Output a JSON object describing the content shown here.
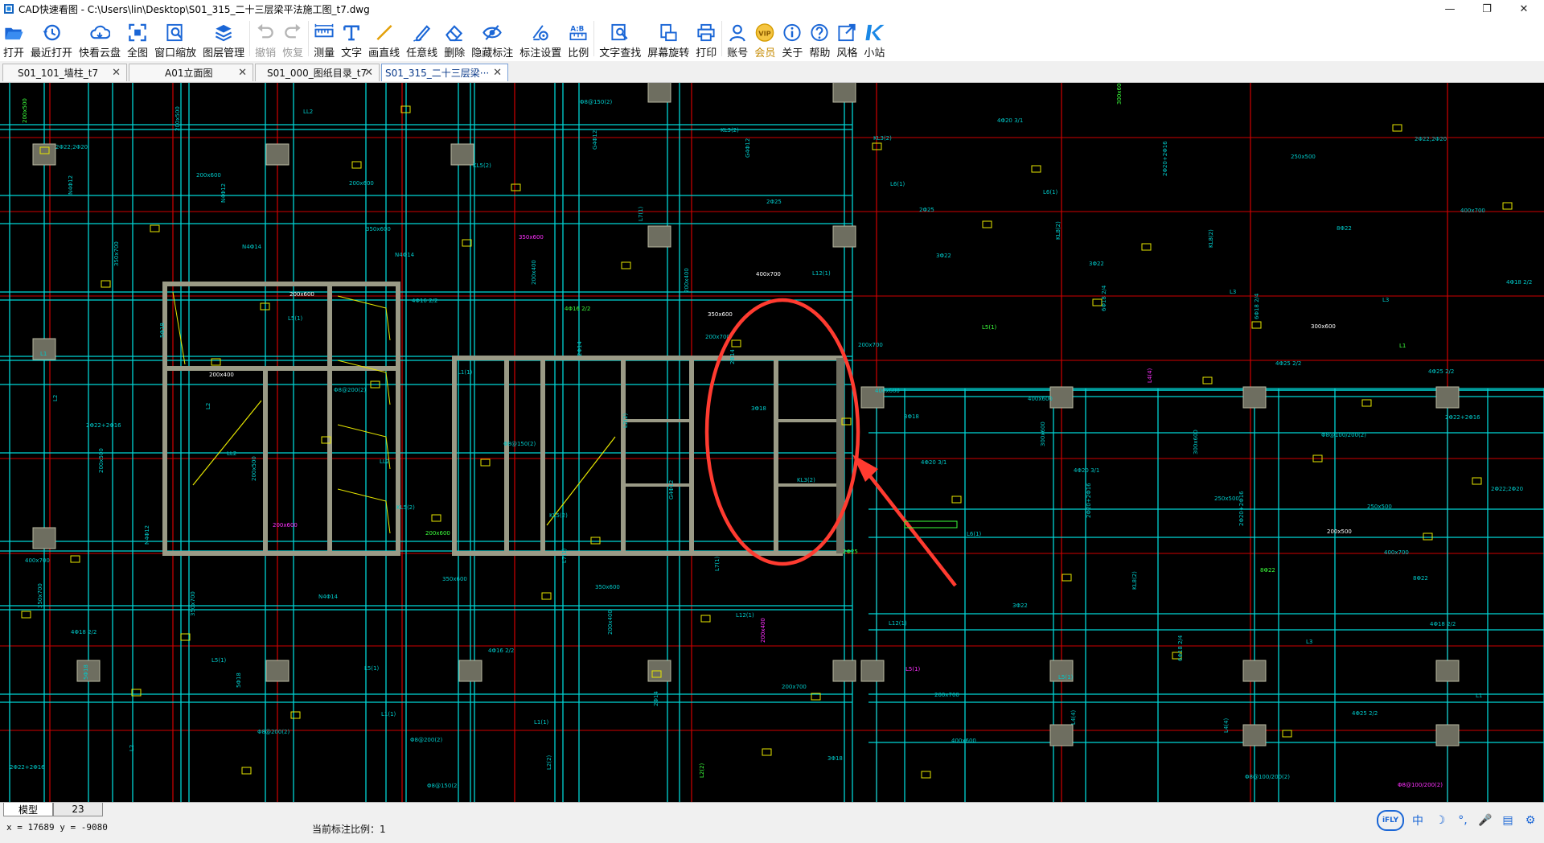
{
  "window": {
    "title": "CAD快速看图 - C:\\Users\\lin\\Desktop\\S01_315_二十三层梁平法施工图_t7.dwg",
    "controls": [
      "—",
      "❐",
      "✕"
    ]
  },
  "toolbar": {
    "items": [
      {
        "key": "open",
        "label": "打开",
        "icon": "folder-open-icon"
      },
      {
        "key": "recent",
        "label": "最近打开",
        "icon": "clock-history-icon"
      },
      {
        "key": "cloud",
        "label": "快看云盘",
        "icon": "cloud-icon"
      },
      {
        "key": "fit",
        "label": "全图",
        "icon": "fit-all-icon"
      },
      {
        "key": "zoomwin",
        "label": "窗口缩放",
        "icon": "zoom-window-icon"
      },
      {
        "key": "layers",
        "label": "图层管理",
        "icon": "layers-icon"
      },
      {
        "key": "undo",
        "label": "撤销",
        "icon": "undo-icon",
        "disabled": true
      },
      {
        "key": "redo",
        "label": "恢复",
        "icon": "redo-icon",
        "disabled": true
      },
      {
        "key": "measure",
        "label": "测量",
        "icon": "ruler-icon"
      },
      {
        "key": "text",
        "label": "文字",
        "icon": "text-T-icon"
      },
      {
        "key": "line",
        "label": "画直线",
        "icon": "line-icon"
      },
      {
        "key": "freeline",
        "label": "任意线",
        "icon": "pen-icon"
      },
      {
        "key": "erase",
        "label": "删除",
        "icon": "eraser-icon"
      },
      {
        "key": "hide",
        "label": "隐藏标注",
        "icon": "eye-hide-icon"
      },
      {
        "key": "dimset",
        "label": "标注设置",
        "icon": "dimension-settings-icon"
      },
      {
        "key": "scale",
        "label": "比例",
        "icon": "scale-ab-icon"
      },
      {
        "key": "findtext",
        "label": "文字查找",
        "icon": "find-text-icon"
      },
      {
        "key": "rotate",
        "label": "屏幕旋转",
        "icon": "rotate-screen-icon"
      },
      {
        "key": "print",
        "label": "打印",
        "icon": "printer-icon"
      },
      {
        "key": "account",
        "label": "账号",
        "icon": "user-icon"
      },
      {
        "key": "vip",
        "label": "会员",
        "icon": "vip-badge-icon",
        "vip": true
      },
      {
        "key": "about",
        "label": "关于",
        "icon": "info-icon"
      },
      {
        "key": "help",
        "label": "帮助",
        "icon": "help-icon"
      },
      {
        "key": "style",
        "label": "风格",
        "icon": "style-share-icon"
      },
      {
        "key": "site",
        "label": "小站",
        "icon": "k-logo-icon"
      }
    ]
  },
  "tabs": [
    {
      "label": "S01_101_墙柱_t7",
      "active": false
    },
    {
      "label": "A01立面图",
      "active": false
    },
    {
      "label": "S01_000_图纸目录_t7",
      "active": false
    },
    {
      "label": "S01_315_二十三层梁···",
      "active": true
    }
  ],
  "tab_close": "✕",
  "layout_tabs": {
    "model": "模型",
    "layout": "23"
  },
  "status": {
    "coords": "x = 17689  y = -9080",
    "scale": "当前标注比例：1"
  },
  "ime": {
    "logo": "iFLY",
    "items": [
      "中",
      "☽",
      "°,",
      "🎤",
      "▤",
      "⚙"
    ]
  },
  "drawing": {
    "colors": {
      "background": "#000000",
      "beam": "#00d5d5",
      "axis": "#d00000",
      "wall": "#9a9a86",
      "text_cyan": "#00c8c8",
      "text_green": "#3cff3c",
      "text_magenta": "#ff30ff",
      "yellow": "#e6e600",
      "markup": "#ff3b30"
    },
    "annotations": [
      "200x500",
      "200x600",
      "350x600",
      "200x400",
      "200x700",
      "400x600",
      "300x600",
      "250x500",
      "400x700",
      "350x700",
      "L5(1)",
      "L1(1)",
      "L2(2)",
      "KL3(2)",
      "L6(1)",
      "KL8(2)",
      "L3",
      "L1",
      "L2",
      "LL2",
      "KL5(2)",
      "L7(1)",
      "L12(1)",
      "L5(1)",
      "L4(4)",
      "Φ8@100/200(2)",
      "2Φ22;2Φ20",
      "N4Φ12",
      "N4Φ14",
      "4Φ16 2/2",
      "2Φ14",
      "3Φ18",
      "4Φ20 3/1",
      "2Φ20+2Φ16",
      "8Φ22",
      "4Φ18 2/2",
      "5Φ18",
      "Φ8@200(2)",
      "Φ8@150(2)",
      "G4Φ12",
      "2Φ25",
      "3Φ22",
      "6Φ18 2/4",
      "4Φ25 2/2",
      "2Φ22+2Φ16"
    ]
  }
}
